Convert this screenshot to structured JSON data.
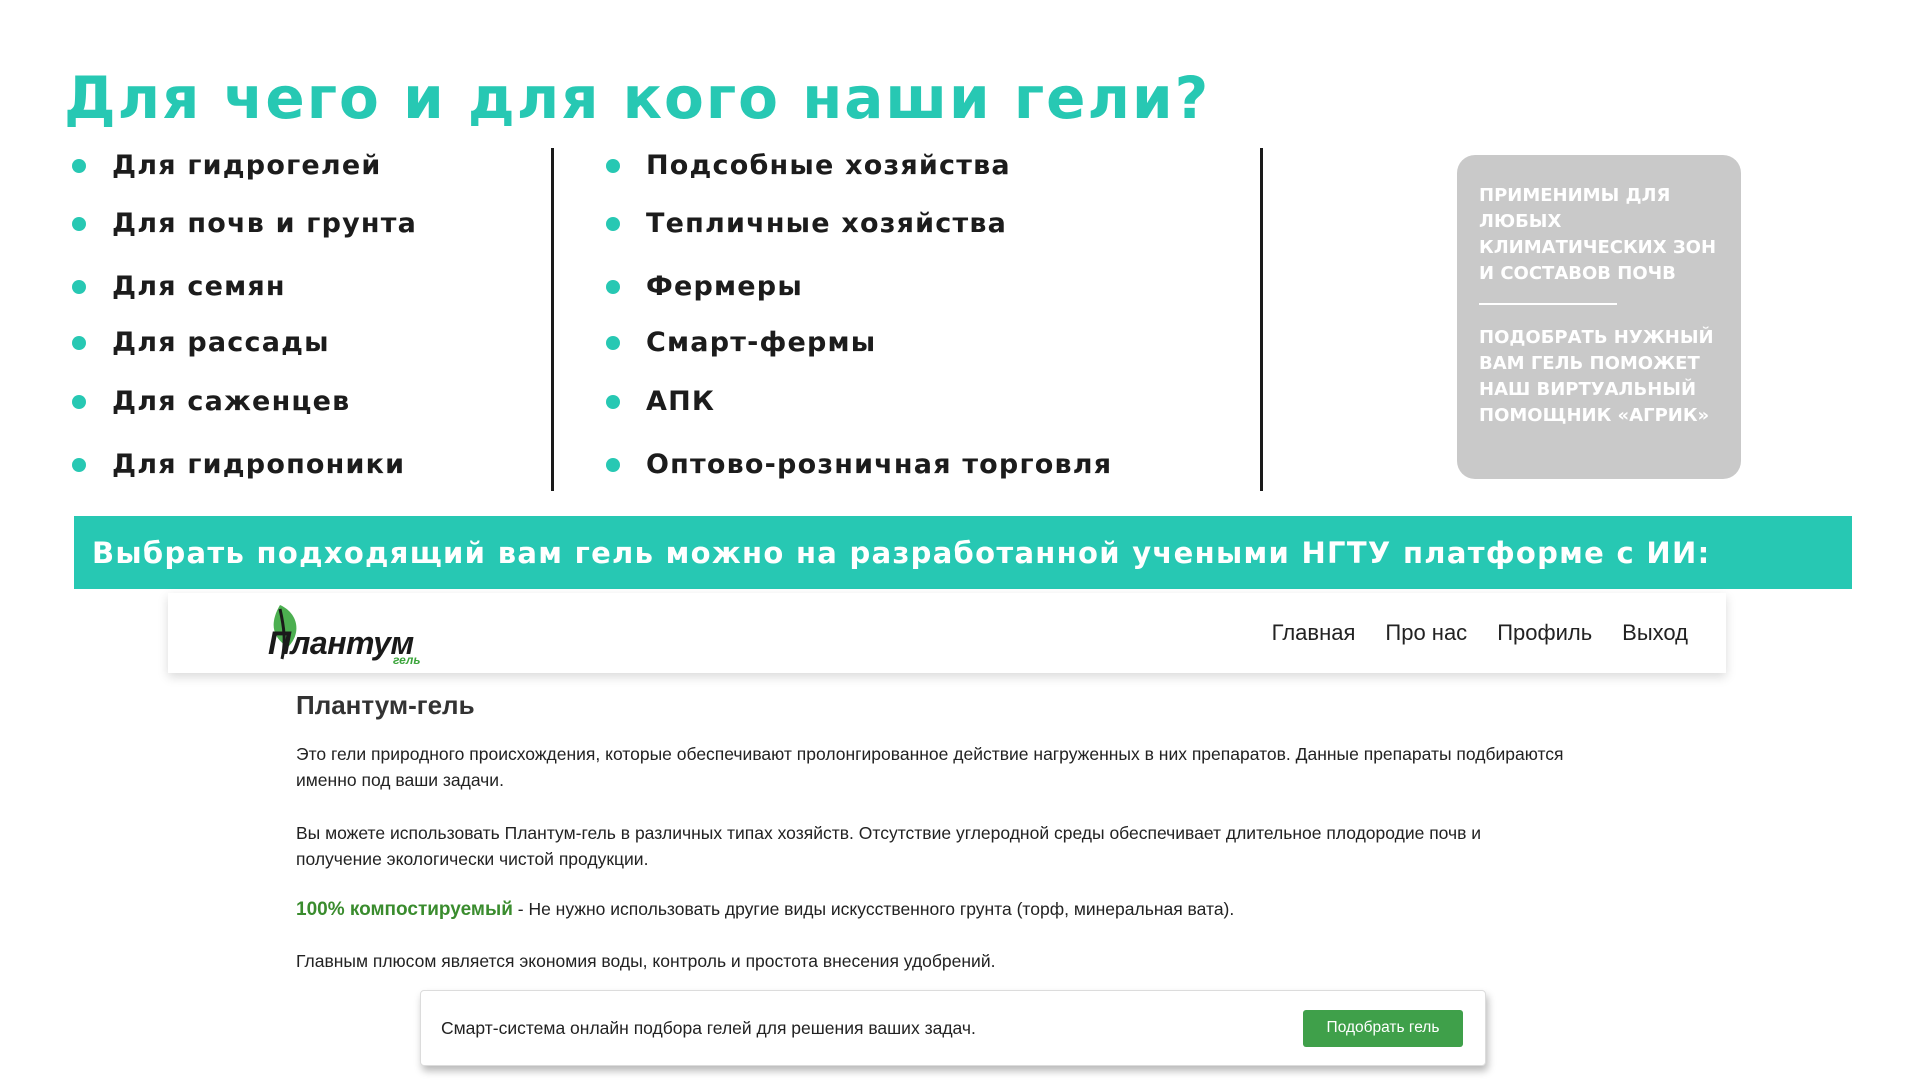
{
  "slide": {
    "title": "Для чего и для кого наши гели?",
    "uses": [
      "Для гидрогелей",
      "Для почв и грунта",
      "Для семян",
      "Для рассады",
      "Для саженцев",
      "Для гидропоники"
    ],
    "audiences": [
      "Подсобные хозяйства",
      "Тепличные хозяйства",
      "Фермеры",
      "Смарт-фермы",
      "АПК",
      "Оптово-розничная торговля"
    ],
    "info_card": {
      "text1": "Применимы для любых климатических зон и составов почв",
      "text2": "Подобрать нужный вам гель поможет наш виртуальный помощник «Агрик»"
    },
    "banner": "Выбрать подходящий вам гель можно на разработанной учеными НГТУ платформе с ИИ:"
  },
  "site": {
    "logo_text": "Плантум",
    "logo_sub": "гель",
    "nav": [
      "Главная",
      "Про нас",
      "Профиль",
      "Выход"
    ],
    "page_title": "Плантум-гель",
    "para1": "Это гели природного происхождения, которые обеспечивают пролонгированное действие нагруженных в них препаратов. Данные препараты подбираются именно под ваши задачи.",
    "para2": "Вы можете использовать Плантум-гель в различных типах хозяйств. Отсутствие углеродной среды обеспечивает длительное плодородие почв и получение экологически чистой продукции.",
    "para3_highlight": "100% компостируемый",
    "para3_rest": " - Не нужно использовать другие виды искусственного грунта (торф, минеральная вата).",
    "para4": "Главным плюсом является экономия воды, контроль и простота внесения удобрений.",
    "cta_text": "Смарт-система онлайн подбора гелей для решения ваших задач.",
    "cta_button": "Подобрать гель"
  },
  "colors": {
    "accent": "#27c8b3",
    "card": "#c9c9c9",
    "green": "#3fa04a"
  }
}
